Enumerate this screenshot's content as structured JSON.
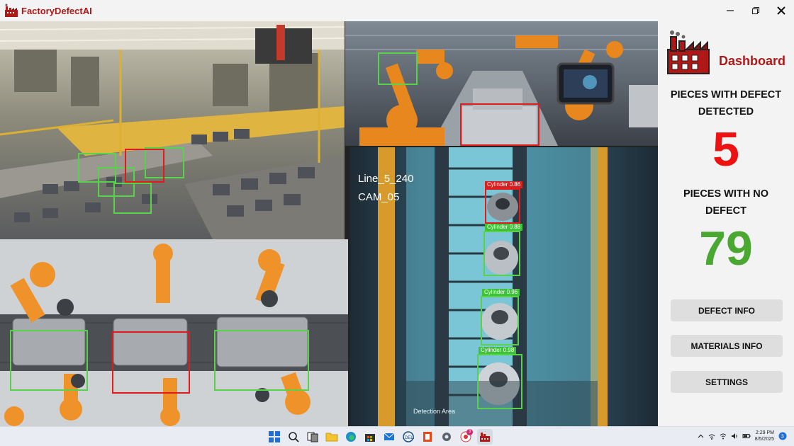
{
  "window": {
    "title": "FactoryDefectAI"
  },
  "feeds": {
    "cam4": {
      "line": "Line_5_240",
      "cam": "CAM_05",
      "detection_area": "Detection Area",
      "detections": [
        "Cylinder 0.86",
        "Cylinder 0.88",
        "Cylinder 0.96",
        "Cylinder 0.98"
      ]
    }
  },
  "sidebar": {
    "title": "Dashboard",
    "defect_label": "PIECES WITH DEFECT DETECTED",
    "defect_count": "5",
    "no_defect_label": "PIECES WITH NO DEFECT",
    "no_defect_count": "79",
    "buttons": {
      "defect_info": "DEFECT INFO",
      "materials_info": "MATERIALS INFO",
      "settings": "SETTINGS"
    }
  },
  "taskbar": {
    "time": "2:29 PM",
    "date": "8/5/2025",
    "notification_count": "3"
  },
  "colors": {
    "brand": "#b01818",
    "defect": "#ee1111",
    "no_defect": "#4aa832",
    "box_ok": "#58d24a",
    "box_bad": "#e21a1a"
  }
}
